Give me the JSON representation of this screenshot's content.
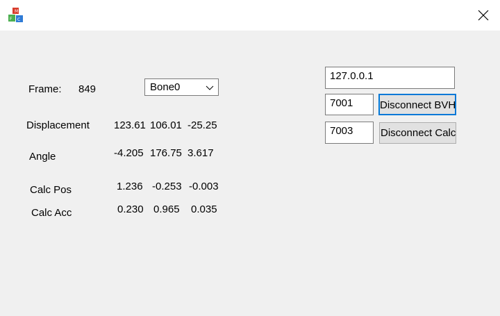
{
  "window": {
    "app_icon": "blocks-icon",
    "close_icon": "close-icon"
  },
  "frame": {
    "label": "Frame:",
    "value": "849"
  },
  "bone_select": {
    "selected": "Bone0"
  },
  "rows": [
    {
      "label": "Displacement",
      "values": [
        "123.61",
        "106.01",
        "-25.25"
      ]
    },
    {
      "label": "Angle",
      "values": [
        "-4.205",
        "176.75",
        "3.617"
      ]
    },
    {
      "label": "Calc Pos",
      "values": [
        "1.236",
        "-0.253",
        "-0.003"
      ]
    },
    {
      "label": "Calc Acc",
      "values": [
        "0.230",
        "0.965",
        "0.035"
      ]
    }
  ],
  "connection": {
    "ip": "127.0.0.1",
    "bvh_port": "7001",
    "calc_port": "7003",
    "disconnect_bvh_label": "Disconnect BVH",
    "disconnect_calc_label": "Disconnect Calc"
  },
  "colors": {
    "background": "#f0f0f0",
    "titlebar": "#ffffff",
    "focus_border": "#0078d7",
    "button_face": "#e1e1e1"
  }
}
